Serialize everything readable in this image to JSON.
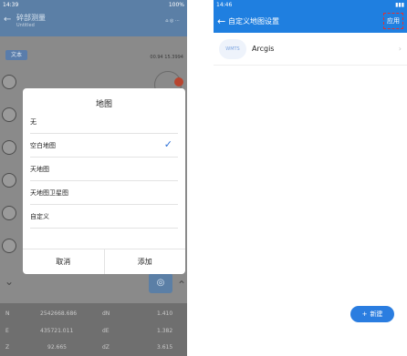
{
  "left": {
    "status_time": "14:39",
    "status_right": "100%",
    "title": "碎部测量",
    "subtitle": "Untitled",
    "text_button": "文本",
    "coordinate": "00.94 15.3994",
    "dialog": {
      "title": "地图",
      "options": [
        {
          "label": "无",
          "selected": false
        },
        {
          "label": "空白地图",
          "selected": true
        },
        {
          "label": "天地图",
          "selected": false
        },
        {
          "label": "天地图卫星图",
          "selected": false
        },
        {
          "label": "自定义",
          "selected": false
        }
      ],
      "cancel": "取消",
      "add": "添加"
    },
    "bottom_rows": [
      {
        "k": "N",
        "v": "2542668.686",
        "dk": "dN",
        "dv": "1.410"
      },
      {
        "k": "E",
        "v": "435721.011",
        "dk": "dE",
        "dv": "1.382"
      },
      {
        "k": "Z",
        "v": "92.665",
        "dk": "dZ",
        "dv": "3.615"
      }
    ]
  },
  "right": {
    "status_time": "14:46",
    "title": "自定义地图设置",
    "apply": "应用",
    "item_tag": "WMTS",
    "item_label": "Arcgis",
    "new_button": "新建"
  }
}
